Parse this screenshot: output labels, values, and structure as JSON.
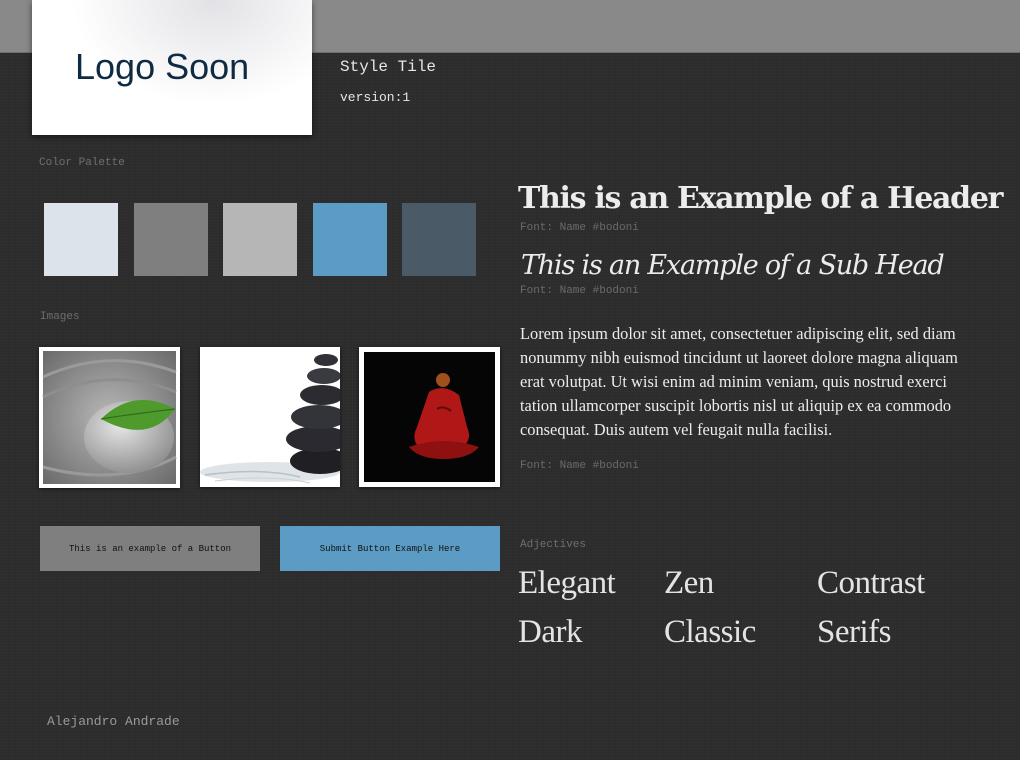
{
  "logo": {
    "text": "Logo Soon"
  },
  "tile": {
    "title": "Style Tile",
    "version": "version:1"
  },
  "palette": {
    "label": "Color Palette",
    "colors": [
      "#dde3ea",
      "#7f7f7f",
      "#b6b6b6",
      "#5b9bc4",
      "#4a5a66"
    ]
  },
  "images": {
    "label": "Images",
    "items": [
      "zen-stone-leaf-image",
      "stacked-stones-image",
      "meditating-monk-image"
    ]
  },
  "buttons": {
    "primary_label": "This is an example of a Button",
    "submit_label": "Submit Button Example Here"
  },
  "typography": {
    "header": "This is an Example of a Header",
    "header_font": "Font: Name #bodoni",
    "subhead": "This is an Example of a Sub Head",
    "subhead_font": "Font: Name #bodoni",
    "body": "Lorem ipsum dolor sit amet, consectetuer adipiscing elit, sed diam nonummy nibh euismod tincidunt ut laoreet dolore magna aliquam erat volutpat. Ut wisi enim ad minim veniam, quis nostrud exerci tation ullamcorper suscipit lobortis nisl ut aliquip ex ea commodo consequat. Duis autem vel feugait nulla facilisi.",
    "body_font": "Font: Name #bodoni"
  },
  "adjectives": {
    "label": "Adjectives",
    "words": [
      "Elegant",
      "Zen",
      "Contrast",
      "Dark",
      "Classic",
      "Serifs"
    ]
  },
  "author": "Alejandro Andrade"
}
